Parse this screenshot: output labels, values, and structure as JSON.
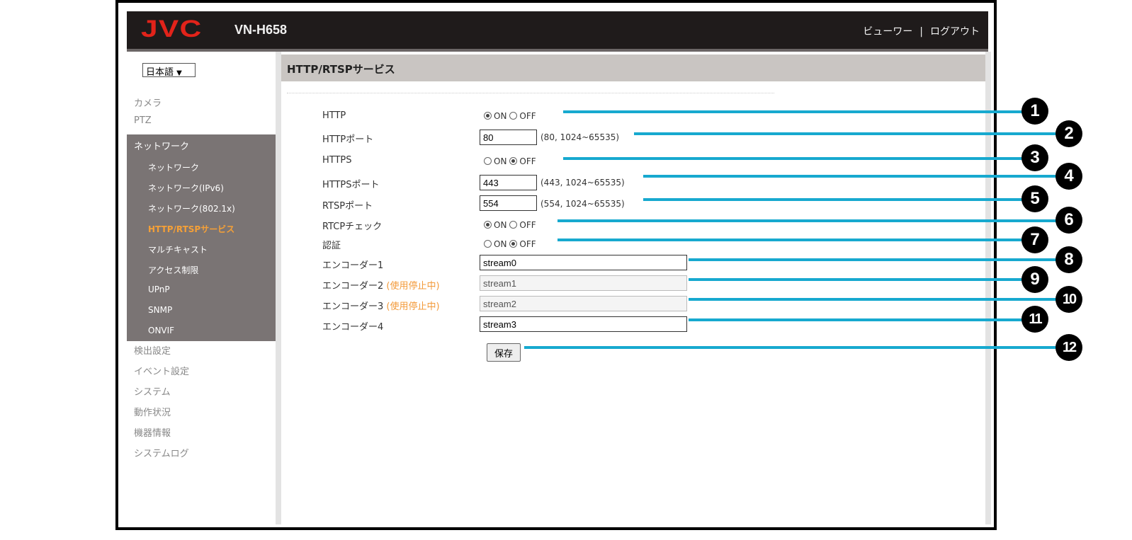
{
  "header": {
    "logo": "JVC",
    "model": "VN-H658",
    "viewer_link": "ビューワー",
    "separator": "|",
    "logout_link": "ログアウト"
  },
  "sidebar": {
    "language": "日本語",
    "items_top": [
      "カメラ",
      "PTZ"
    ],
    "network_header": "ネットワーク",
    "network_items": [
      "ネットワーク",
      "ネットワーク(IPv6)",
      "ネットワーク(802.1x)",
      "HTTP/RTSPサービス",
      "マルチキャスト",
      "アクセス制限",
      "UPnP",
      "SNMP",
      "ONVIF"
    ],
    "items_bottom": [
      "検出設定",
      "イベント設定",
      "システム",
      "動作状況",
      "機器情報",
      "システムログ"
    ]
  },
  "page": {
    "title": "HTTP/RTSPサービス"
  },
  "form": {
    "http_label": "HTTP",
    "http_port_label": "HTTPポート",
    "https_label": "HTTPS",
    "https_port_label": "HTTPSポート",
    "rtsp_port_label": "RTSPポート",
    "rtcp_label": "RTCPチェック",
    "auth_label": "認証",
    "on": "ON",
    "off": "OFF",
    "http_port": "80",
    "http_port_hint": "(80, 1024~65535)",
    "https_port": "443",
    "https_port_hint": "(443, 1024~65535)",
    "rtsp_port": "554",
    "rtsp_port_hint": "(554, 1024~65535)",
    "encoder1_label": "エンコーダー1",
    "encoder2_label": "エンコーダー2",
    "encoder3_label": "エンコーダー3",
    "encoder4_label": "エンコーダー4",
    "disabled_note": "(使用停止中)",
    "encoder1": "stream0",
    "encoder2": "stream1",
    "encoder3": "stream2",
    "encoder4": "stream3",
    "save": "保存"
  },
  "callouts": [
    "1",
    "2",
    "3",
    "4",
    "5",
    "6",
    "7",
    "8",
    "9",
    "10",
    "11",
    "12"
  ],
  "colors": {
    "accent": "#17a9cf",
    "brand": "#e2231a",
    "active_nav": "#f5a037"
  }
}
